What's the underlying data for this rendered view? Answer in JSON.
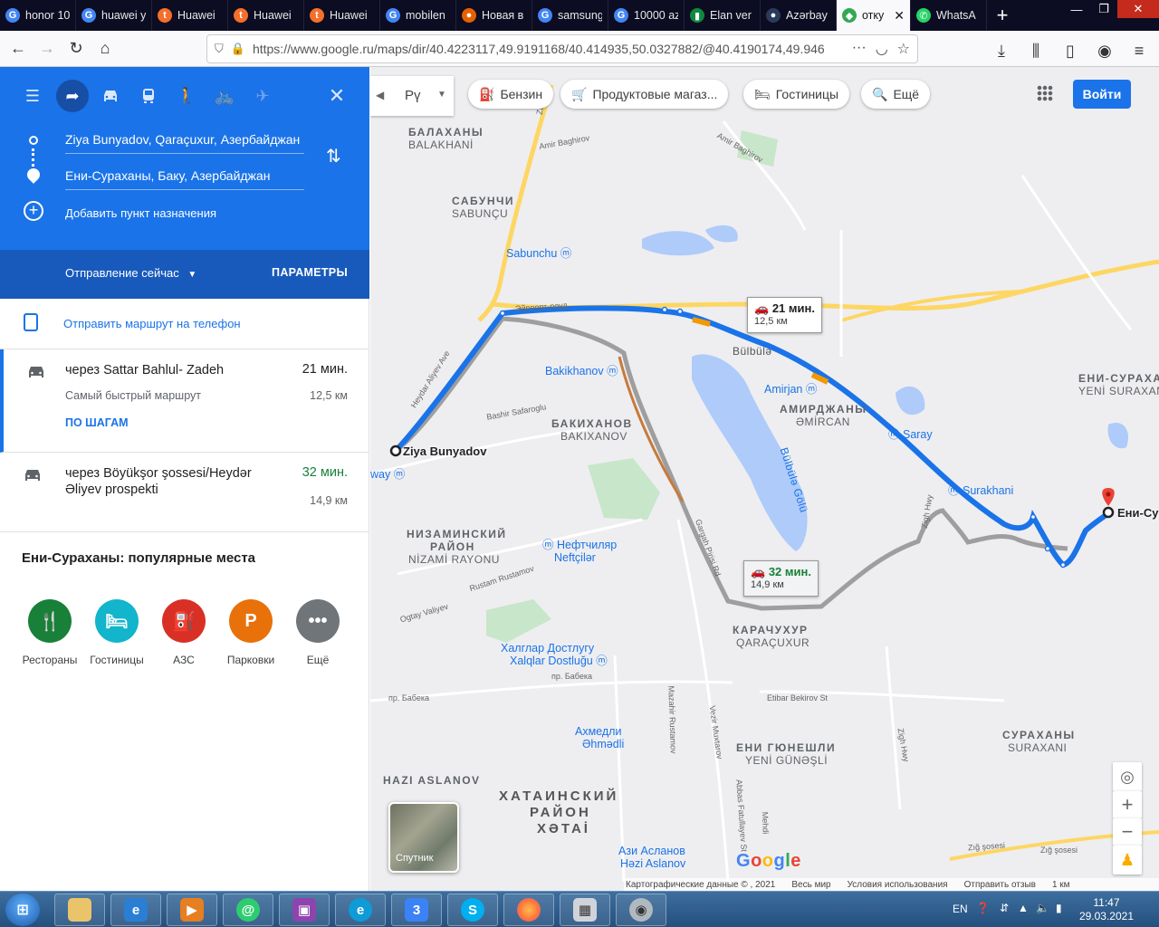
{
  "browser": {
    "tabs": [
      {
        "label": "honor 10",
        "fav": "G",
        "color": "#4285f4"
      },
      {
        "label": "huawei y",
        "fav": "G",
        "color": "#4285f4"
      },
      {
        "label": "Huawei",
        "fav": "t",
        "color": "#f56f2a"
      },
      {
        "label": "Huawei",
        "fav": "t",
        "color": "#f56f2a"
      },
      {
        "label": "Huawei",
        "fav": "t",
        "color": "#f56f2a"
      },
      {
        "label": "mobilen",
        "fav": "G",
        "color": "#4285f4"
      },
      {
        "label": "Новая в",
        "fav": "●",
        "color": "#e66000"
      },
      {
        "label": "samsung",
        "fav": "G",
        "color": "#4285f4"
      },
      {
        "label": "10000 az",
        "fav": "G",
        "color": "#4285f4"
      },
      {
        "label": "Elan ver",
        "fav": "▮",
        "color": "#0d8a3e"
      },
      {
        "label": "Azərbay",
        "fav": "●",
        "color": "#2a3a5a"
      }
    ],
    "active_tab": "отку",
    "last_tab": "WhatsA",
    "url": "https://www.google.ru/maps/dir/40.4223117,49.9191168/40.414935,50.0327882/@40.4190174,49.946"
  },
  "directions": {
    "origin": "Ziya Bunyadov, Qaraçuxur, Азербайджан",
    "destination": "Ени-Сураханы, Баку, Азербайджан",
    "add_destination": "Добавить пункт назначения",
    "depart": "Отправление сейчас",
    "options": "ПАРАМЕТРЫ",
    "send_to_phone": "Отправить маршрут на телефон",
    "routes": [
      {
        "via": "через Sattar Bahlul- Zadeh",
        "time": "21 мин.",
        "distance": "12,5 км",
        "subtitle": "Самый быстрый маршрут",
        "steps": "ПО ШАГАМ",
        "time_color": "#202124"
      },
      {
        "via": "через Böyükşor şossesi/Heydər Əliyev prospekti",
        "time": "32 мин.",
        "distance": "14,9 км",
        "time_color": "#188038"
      }
    ],
    "popular_title": "Ени-Сураханы: популярные места",
    "categories": [
      {
        "label": "Рестораны",
        "icon": "fork-knife",
        "color": "#188038",
        "glyph": "🍴"
      },
      {
        "label": "Гостиницы",
        "icon": "bed",
        "color": "#12b5cb",
        "glyph": "🛏"
      },
      {
        "label": "АЗС",
        "icon": "gas",
        "color": "#d93025",
        "glyph": "⛽"
      },
      {
        "label": "Парковки",
        "icon": "parking",
        "color": "#e8710a",
        "glyph": "P"
      },
      {
        "label": "Ещё",
        "icon": "more",
        "color": "#70757a",
        "glyph": "•••"
      }
    ]
  },
  "map": {
    "lang_button": "Рү",
    "chips": [
      "Бензин",
      "Продуктовые магаз...",
      "Гостиницы",
      "Ещё"
    ],
    "signin": "Войти",
    "route_box_1": {
      "time": "21 мин.",
      "dist": "12,5 км"
    },
    "route_box_2": {
      "time": "32 мин.",
      "dist": "14,9 км"
    },
    "start_label": "Ziya Bunyadov",
    "end_label": "Ени-Су",
    "satellite": "Спутник",
    "google": "Google",
    "attribution": [
      "Картографические данные © , 2021",
      "Весь мир",
      "Условия использования",
      "Отправить отзыв",
      "1 км"
    ],
    "places": {
      "balakhany": "БАЛАХАНЫ",
      "balakhani": "BALAKHANİ",
      "sabunchi_ru": "САБУНЧИ",
      "sabunchu": "SABUNÇU",
      "bakikhanov_ru": "БАКИХАНОВ",
      "bakixanov": "BAKIXANOV",
      "amirdzhany": "АМИРДЖАНЫ",
      "amircan": "ƏMİRCAN",
      "yeni_ru": "ЕНИ-СУРАХАН",
      "yeni_az": "YENİ SURAXAN",
      "nizami_ru1": "НИЗАМИНСКИЙ",
      "nizami_ru2": "РАЙОН",
      "nizami_az": "NİZAMİ RAYONU",
      "karachukhur": "КАРАЧУХУР",
      "qaracuxur": "QARAÇUXUR",
      "yeni_gun_ru": "ЕНИ ГЮНЕШЛИ",
      "yeni_gun_az": "YENİ GÜNƏŞLİ",
      "surakhany_ru": "СУРАХАНЫ",
      "suraxani": "SURAXANI",
      "hazi": "HAZI ASLANOV",
      "khatai1": "ХАТАИНСКИЙ",
      "khatai2": "РАЙОН",
      "xetai": "XƏTAİ",
      "bulbule": "Bülbülə",
      "lake": "Bülbülə Gölü"
    },
    "metros": {
      "sabunchu": "Sabunchu",
      "bakikhanov": "Bakikhanov",
      "amirjan": "Amirjan",
      "saray": "Saray",
      "surakhani": "Surakhani",
      "neft1": "Нефтчиляр",
      "neft2": "Neftçilər",
      "khal1": "Халглар Достлугу",
      "khal2": "Xalqlar Dostluğu",
      "akh1": "Ахмедли",
      "akh2": "Əhmədli",
      "azi1": "Ази Асланов",
      "azi2": "Həzi Aslanov",
      "way": "way"
    },
    "roads": {
      "airport": "Эйрпорт-роуд",
      "heydar": "Heydar Aliyev Ave",
      "bashir": "Bashir Safaroglu",
      "amir": "Amir Baghirov",
      "amir2": "Amir Baghirov",
      "gargah": "Gargah Pirisi Rd",
      "rustam": "Rustam Rustamov",
      "ogtay": "Ogtay Valiyev",
      "babek": "пр. Бабека",
      "babek2": "пр. Бабека",
      "zigh": "Zigh Hwy",
      "zigh2": "Zigh Hwy",
      "zigsos": "Zığ şosesi",
      "zigsos2": "Zığ şosesi",
      "etibar": "Etibar Bekirov St",
      "mazahir": "Маzаhir Rustamov",
      "vezir": "Vezir Muxtarov",
      "abbas": "Abbas Fatullayev St",
      "bedel": "Mehdi",
      "zab": "Zab"
    }
  },
  "taskbar": {
    "lang": "EN",
    "time": "11:47",
    "date": "29.03.2021"
  }
}
